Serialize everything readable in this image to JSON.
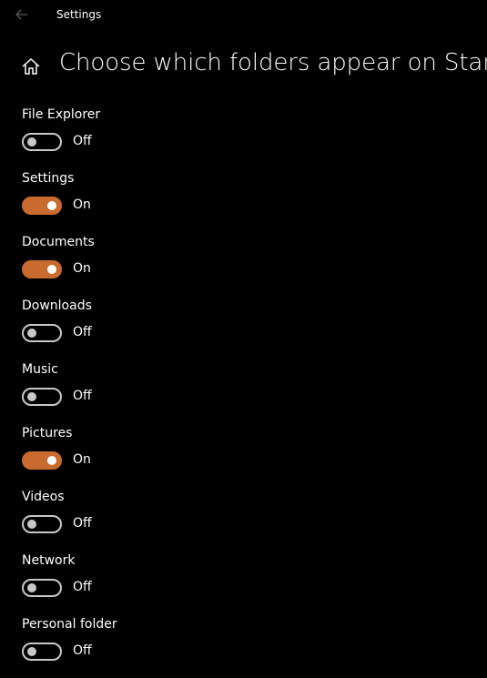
{
  "window": {
    "title": "Settings",
    "back_icon": "back-arrow-icon"
  },
  "header": {
    "home_icon": "home-icon",
    "title": "Choose which folders appear on Start"
  },
  "colors": {
    "accent": "#c96b2e",
    "background": "#000000",
    "text": "#ffffff",
    "toggle_off": "#c8c8c8"
  },
  "folders": [
    {
      "id": "file-explorer",
      "label": "File Explorer",
      "on": false,
      "state": "Off"
    },
    {
      "id": "settings",
      "label": "Settings",
      "on": true,
      "state": "On"
    },
    {
      "id": "documents",
      "label": "Documents",
      "on": true,
      "state": "On"
    },
    {
      "id": "downloads",
      "label": "Downloads",
      "on": false,
      "state": "Off"
    },
    {
      "id": "music",
      "label": "Music",
      "on": false,
      "state": "Off"
    },
    {
      "id": "pictures",
      "label": "Pictures",
      "on": true,
      "state": "On"
    },
    {
      "id": "videos",
      "label": "Videos",
      "on": false,
      "state": "Off"
    },
    {
      "id": "network",
      "label": "Network",
      "on": false,
      "state": "Off"
    },
    {
      "id": "personal-folder",
      "label": "Personal folder",
      "on": false,
      "state": "Off"
    }
  ]
}
